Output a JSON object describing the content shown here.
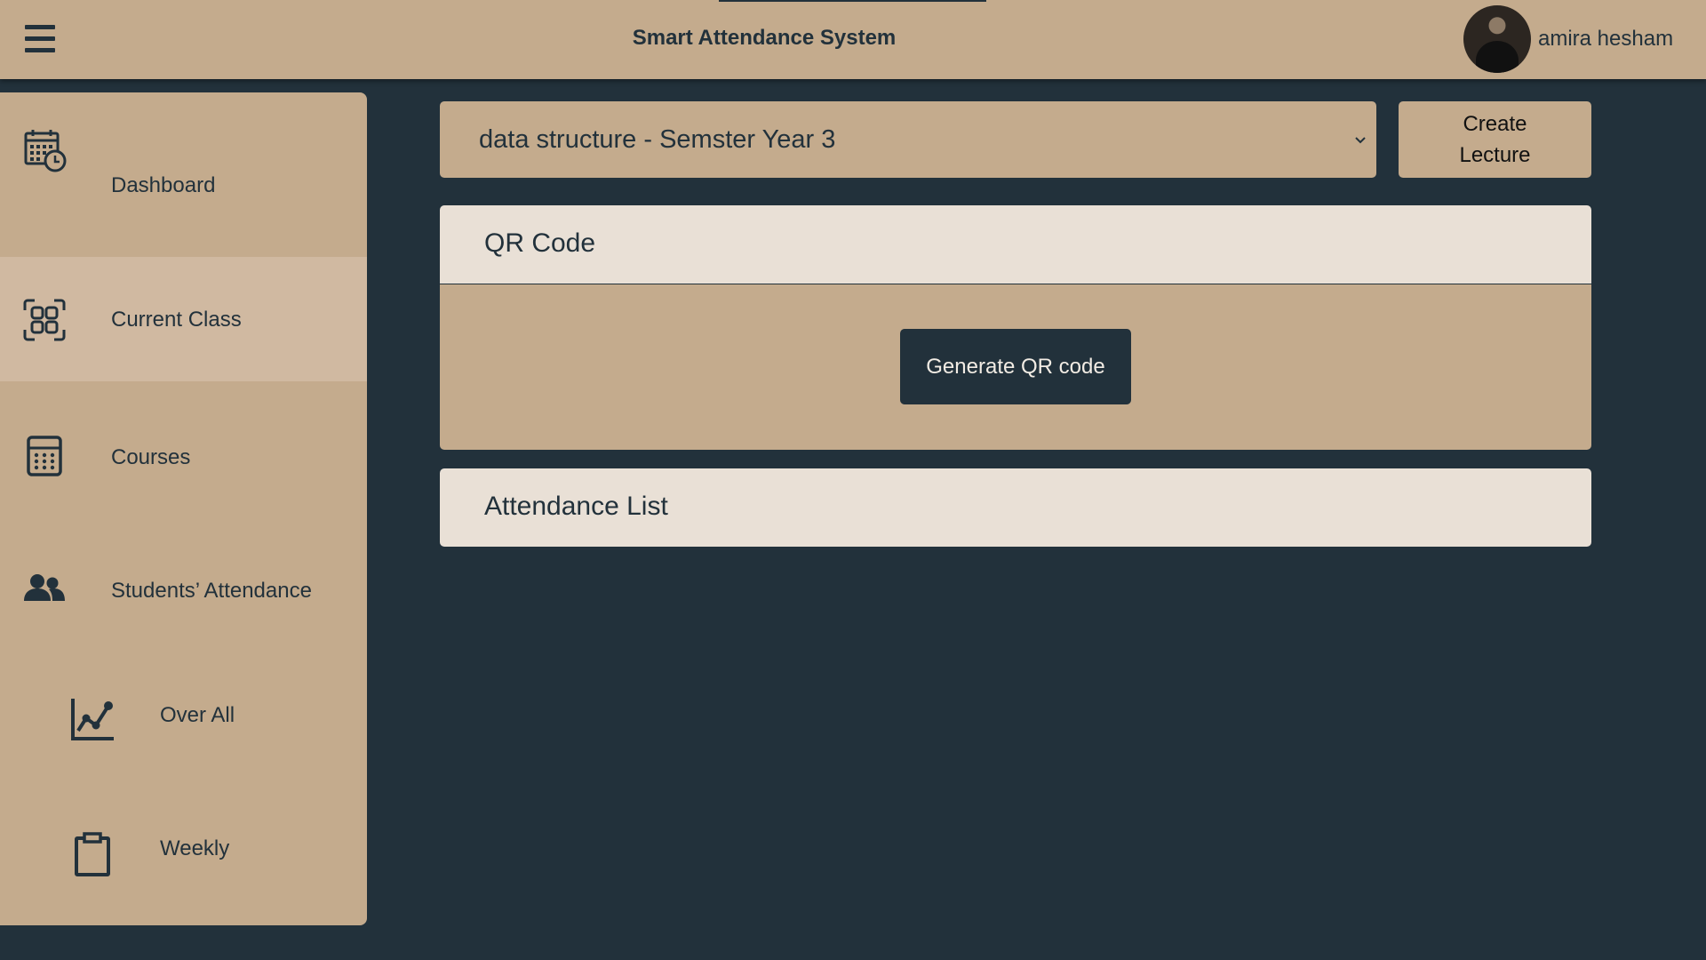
{
  "header": {
    "title": "Smart Attendance System",
    "user_name": "amira hesham",
    "menu_icon": "hamburger-menu-icon",
    "avatar": "user-avatar-photo"
  },
  "sidebar": {
    "items": [
      {
        "label": "Dashboard",
        "icon": "calendar-clock-icon",
        "active": false
      },
      {
        "label": "Current Class",
        "icon": "qr-scan-icon",
        "active": true
      },
      {
        "label": "Courses",
        "icon": "calculator-icon",
        "active": false
      },
      {
        "label": "Students’ Attendance",
        "icon": "users-icon",
        "active": false
      },
      {
        "label": "Over All",
        "icon": "line-chart-icon",
        "active": false,
        "sub": true
      },
      {
        "label": "Weekly",
        "icon": "clipboard-icon",
        "active": false,
        "sub": true
      }
    ]
  },
  "main": {
    "course_select": {
      "value": "data structure - Semster Year 3"
    },
    "create_lecture_label": "Create Lecture",
    "qr_panel": {
      "title": "QR Code",
      "generate_label": "Generate QR code"
    },
    "attendance_panel": {
      "title": "Attendance List"
    }
  },
  "colors": {
    "background": "#22313b",
    "panel_tan": "#c4ab8d",
    "panel_light": "#e9e0d6",
    "active_item": "#d0b9a1"
  }
}
